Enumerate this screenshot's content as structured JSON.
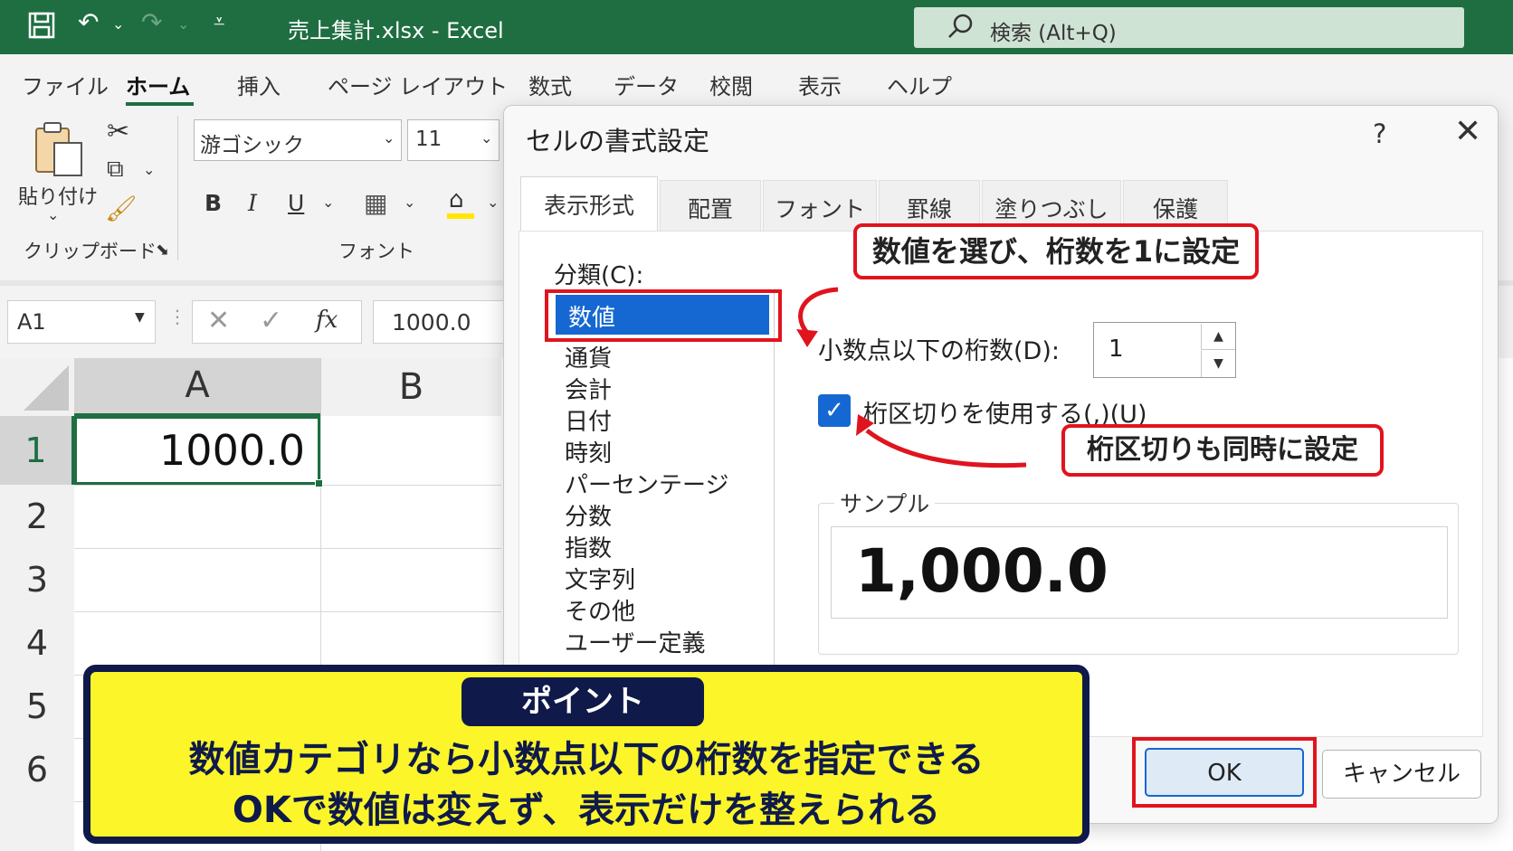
{
  "title_bar": {
    "file_title": "売上集計.xlsx  -  Excel",
    "search_placeholder": "検索 (Alt+Q)"
  },
  "menu": {
    "tabs": [
      "ファイル",
      "ホーム",
      "挿入",
      "ページ レイアウト",
      "数式",
      "データ",
      "校閲",
      "表示",
      "ヘルプ"
    ],
    "active": "ホーム"
  },
  "ribbon": {
    "paste_label": "貼り付け",
    "clipboard_group": "クリップボード",
    "font_name": "游ゴシック",
    "font_size": "11",
    "bold": "B",
    "italic": "I",
    "underline": "U",
    "font_group": "フォント"
  },
  "formula_bar": {
    "name_box": "A1",
    "fx": "fx",
    "value": "1000.0"
  },
  "sheet": {
    "columns": [
      "A",
      "B"
    ],
    "rows": [
      "1",
      "2",
      "3",
      "4",
      "5",
      "6"
    ],
    "cell_a1": "1000.0"
  },
  "dialog": {
    "title": "セルの書式設定",
    "help": "?",
    "tabs": [
      "表示形式",
      "配置",
      "フォント",
      "罫線",
      "塗りつぶし",
      "保護"
    ],
    "active_tab": "表示形式",
    "category_label": "分類(C):",
    "categories": [
      "数値",
      "通貨",
      "会計",
      "日付",
      "時刻",
      "パーセンテージ",
      "分数",
      "指数",
      "文字列",
      "その他",
      "ユーザー定義"
    ],
    "selected_category": "数値",
    "decimals_label": "小数点以下の桁数(D):",
    "decimals_value": "1",
    "thousands_label": "桁区切りを使用する(,)(U)",
    "thousands_checked": true,
    "sample_label": "サンプル",
    "sample_value": "1,000.0",
    "ok_label": "OK",
    "cancel_label": "キャンセル"
  },
  "callouts": {
    "top": "数値を選び、桁数を1に設定",
    "middle": "桁区切りも同時に設定"
  },
  "point": {
    "badge": "ポイント",
    "line1": "数値カテゴリなら小数点以下の桁数を指定できる",
    "line2": "OKで数値は変えず、表示だけを整えられる"
  },
  "colors": {
    "excel_green": "#1e6e41",
    "selection_blue": "#1568d2",
    "callout_red": "#e0141e",
    "point_yellow": "#fbf52a",
    "point_navy": "#0f1a4a"
  }
}
